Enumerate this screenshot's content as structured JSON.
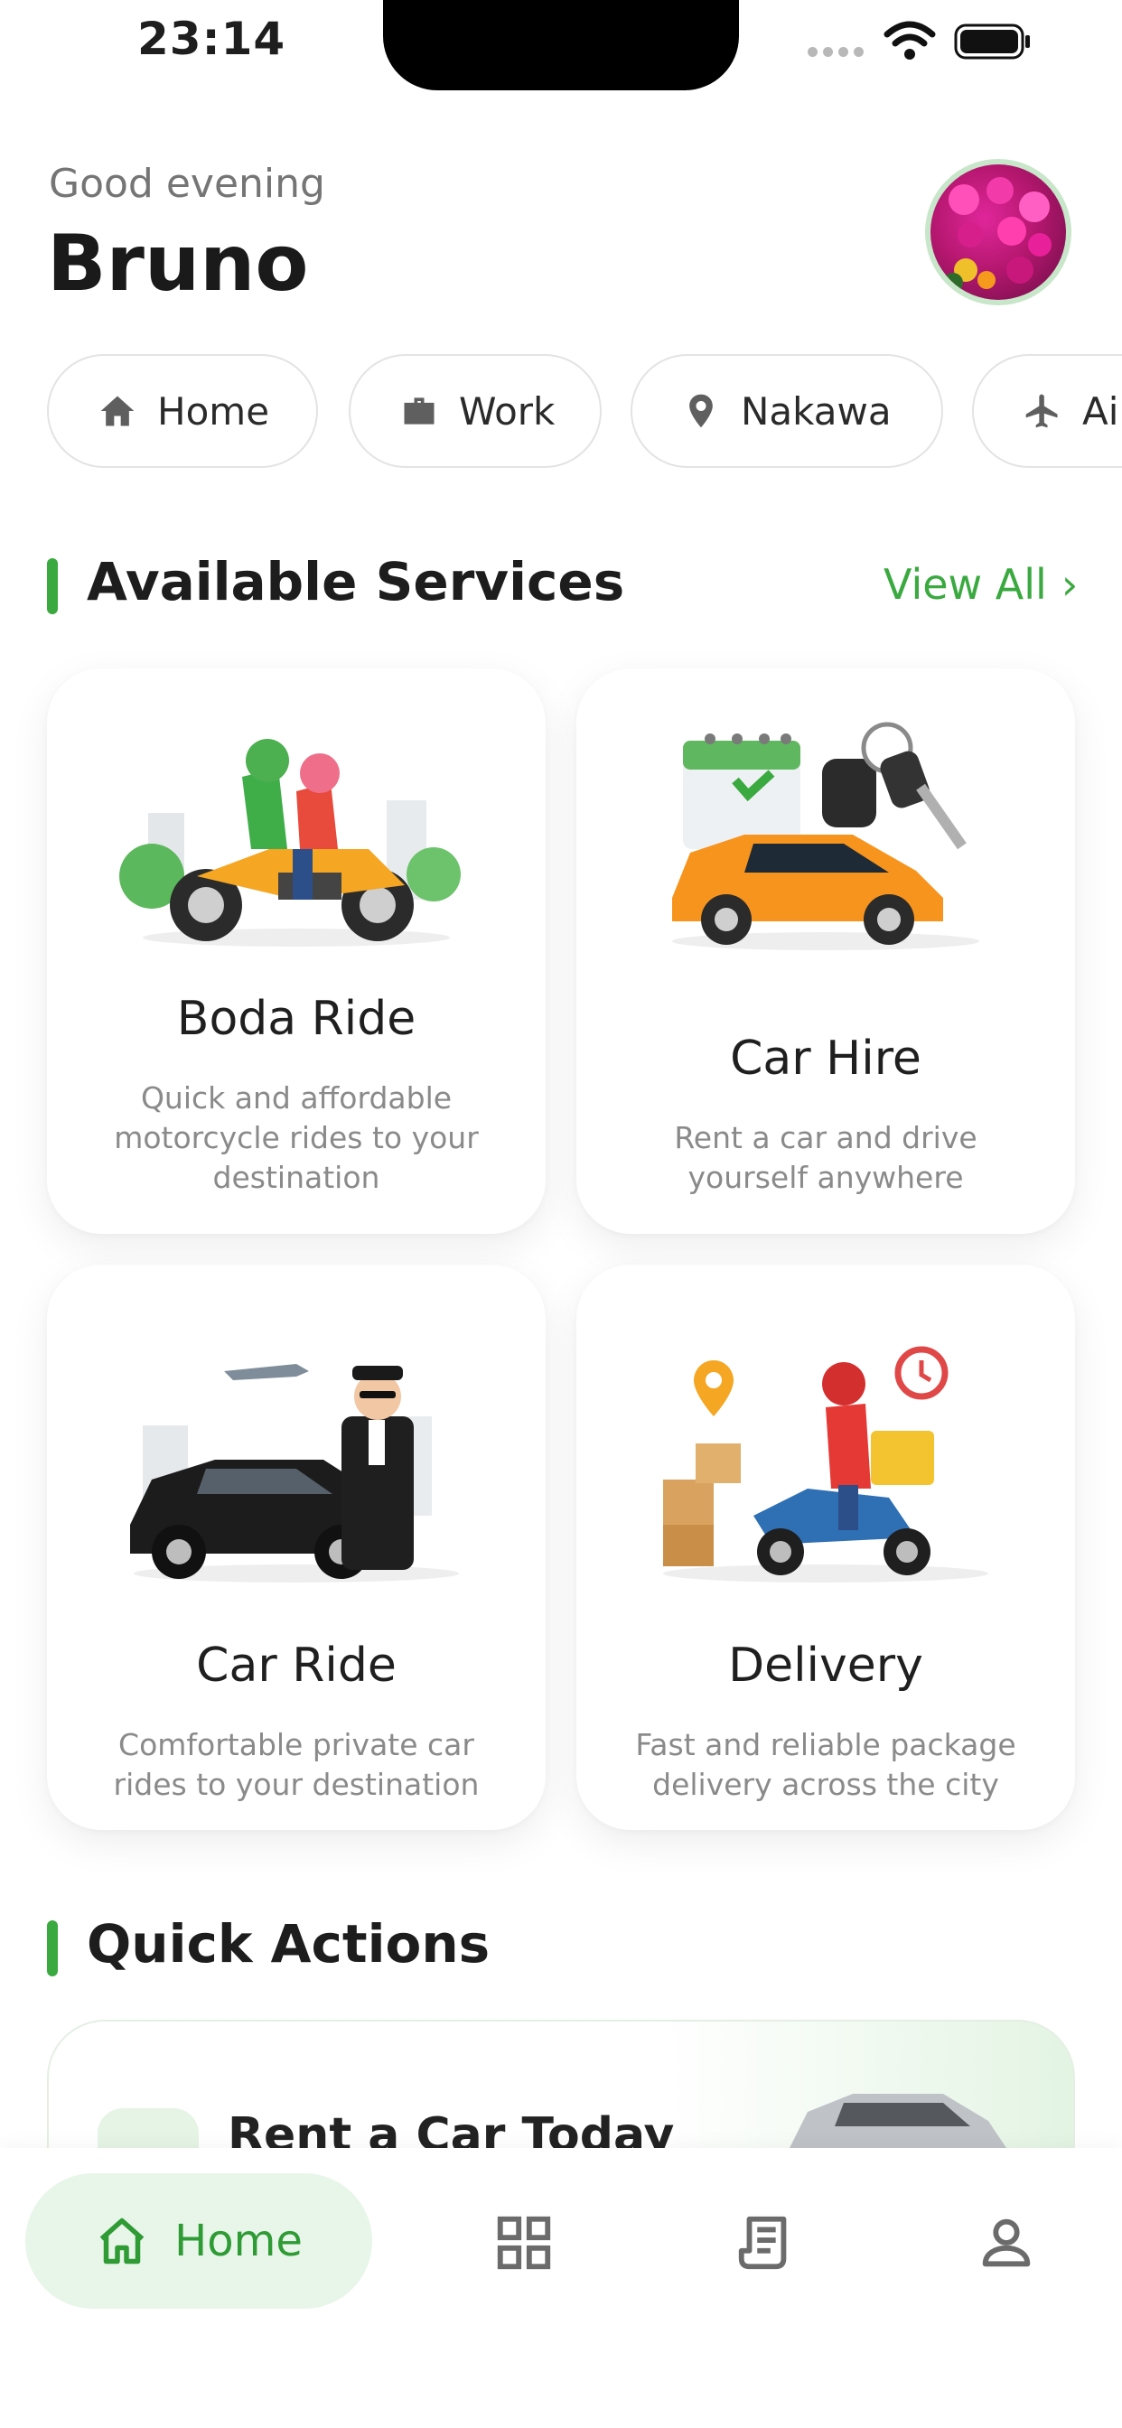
{
  "status_bar": {
    "time": "23:14"
  },
  "header": {
    "greeting": "Good evening",
    "name": "Bruno"
  },
  "places": [
    {
      "label": "Home",
      "icon": "home-icon"
    },
    {
      "label": "Work",
      "icon": "briefcase-icon"
    },
    {
      "label": "Nakawa",
      "icon": "location-pin-icon"
    },
    {
      "label": "Ai",
      "icon": "airplane-icon"
    }
  ],
  "services": {
    "title": "Available Services",
    "view_all": "View All",
    "view_all_chevron": "›",
    "items": [
      {
        "title": "Boda Ride",
        "description": "Quick and affordable motorcycle rides to your destination",
        "icon": "motorcycle-illustration"
      },
      {
        "title": "Car Hire",
        "description": "Rent a car and drive yourself anywhere",
        "icon": "car-keys-illustration"
      },
      {
        "title": "Car Ride",
        "description": "Comfortable private car rides to your destination",
        "icon": "chauffeur-car-illustration"
      },
      {
        "title": "Delivery",
        "description": "Fast and reliable package delivery  across the city",
        "icon": "delivery-scooter-illustration"
      }
    ]
  },
  "quick_actions": {
    "title": "Quick Actions",
    "banner_title": "Rent a Car Today"
  },
  "bottom_nav": {
    "active_label": "Home",
    "items": [
      "home-icon",
      "grid-icon",
      "receipt-icon",
      "profile-icon"
    ]
  },
  "colors": {
    "accent": "#3aa93f",
    "accent_light": "#e8f5e9"
  }
}
